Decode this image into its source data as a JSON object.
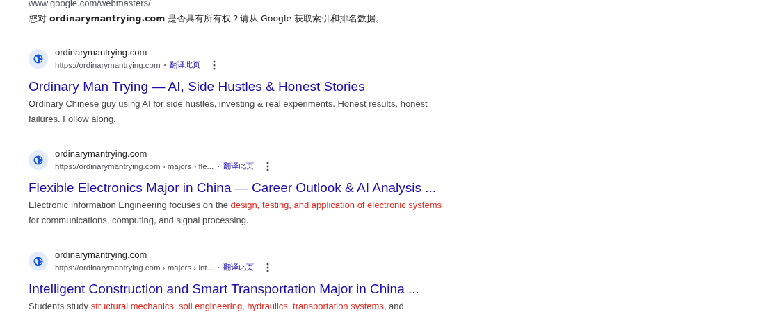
{
  "notice": {
    "url": "www.google.com/webmasters/",
    "text": "您对 **ordinarymantrying.com** 是否具有所有权？请从 Google 获取索引和排名数据。"
  },
  "results": [
    {
      "site": "ordinarymantrying.com",
      "url": "https://ordinarymantrying.com",
      "translate": "翻译此页",
      "title": "Ordinary Man Trying — AI, Side Hustles & Honest Stories",
      "snippet": [
        {
          "text": "Ordinary Chinese guy using AI for side hustles, investing & real experiments. Honest results, honest failures. Follow along.",
          "highlight": false
        }
      ]
    },
    {
      "site": "ordinarymantrying.com",
      "url": "https://ordinarymantrying.com › majors › fle...",
      "translate": "翻译此页",
      "title": "Flexible Electronics Major in China — Career Outlook & AI Analysis ...",
      "snippet": [
        {
          "text": "Electronic Information Engineering focuses on the ",
          "highlight": false
        },
        {
          "text": "design, testing, and application of electronic systems",
          "highlight": true
        },
        {
          "text": " for communications, computing, and signal processing.",
          "highlight": false
        }
      ]
    },
    {
      "site": "ordinarymantrying.com",
      "url": "https://ordinarymantrying.com › majors › int...",
      "translate": "翻译此页",
      "title": "Intelligent Construction and Smart Transportation Major in China ...",
      "snippet": [
        {
          "text": "Students study ",
          "highlight": false
        },
        {
          "text": "structural mechanics, soil engineering, hydraulics, transportation systems",
          "highlight": true
        },
        {
          "text": ", and",
          "highlight": false
        }
      ]
    }
  ]
}
